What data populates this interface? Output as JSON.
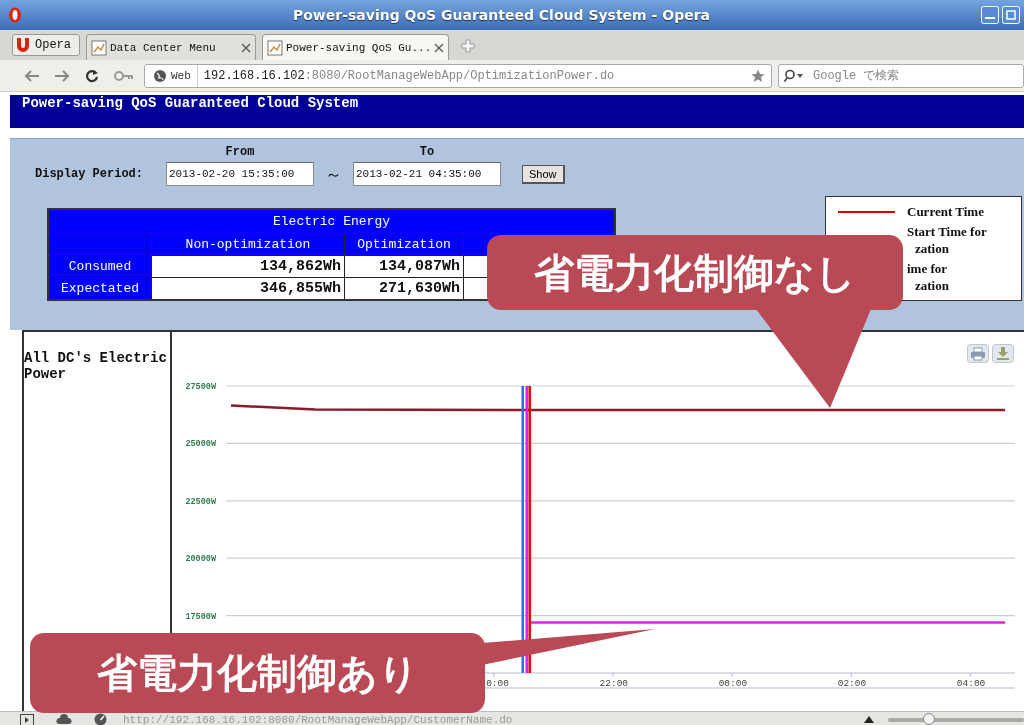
{
  "window": {
    "title": "Power-saving QoS Guaranteed Cloud System - Opera"
  },
  "browser": {
    "menu_label": "Opera",
    "tabs": [
      {
        "label": "Data Center Menu",
        "selected": false
      },
      {
        "label": "Power-saving QoS Gu...",
        "selected": true
      }
    ],
    "address": {
      "badge": "Web",
      "host": "192.168.16.102",
      "path": ":8080/RootManageWebApp/OptimizationPower.do"
    },
    "search": {
      "placeholder": "Google で検索"
    }
  },
  "page": {
    "header": "Power-saving QoS Guaranteed Cloud System",
    "period": {
      "label": "Display Period:",
      "from_label": "From",
      "to_label": "To",
      "from": "2013-02-20 15:35:00",
      "separator": "～",
      "to": "2013-02-21 04:35:00",
      "button": "Show"
    },
    "energy_table": {
      "title": "Electric Energy",
      "columns": [
        "Non-optimization",
        "Optimization"
      ],
      "rows": [
        {
          "label": "Consumed",
          "cells": [
            "134,862Wh",
            "134,087Wh"
          ]
        },
        {
          "label": "Expectated",
          "cells": [
            "346,855Wh",
            "271,630Wh"
          ]
        }
      ]
    },
    "legend": [
      {
        "lines": [
          "Current Time"
        ],
        "color": "#e00000"
      },
      {
        "lines": [
          "Start Time for",
          "zation"
        ]
      },
      {
        "lines": [
          "ime for",
          "zation"
        ]
      }
    ],
    "chart_panel": {
      "title": "All DC's Electric Power",
      "chart_data": {
        "type": "line",
        "grid": true,
        "x": [
          "2013-02-20T15:35",
          "2013-02-20T17:00",
          "2013-02-20T20:30",
          "2013-02-20T20:36",
          "2013-02-21T04:35"
        ],
        "series": [
          {
            "color": "#8b1a2b",
            "values": [
              26650,
              26480,
              26450,
              26450,
              26450
            ]
          },
          {
            "color": "#e020e0",
            "values": [
              null,
              null,
              null,
              17200,
              17200
            ]
          }
        ],
        "xlim": [
          "2013-02-20T15:30",
          "2013-02-21T04:45"
        ],
        "ylim": [
          15000,
          27500
        ],
        "xticks": [
          {
            "value": "2013-02-20T20:00",
            "label": "0:00"
          },
          {
            "value": "2013-02-20T22:00",
            "label": "22:00"
          },
          {
            "value": "2013-02-21T00:00",
            "label": "00:00"
          },
          {
            "value": "2013-02-21T02:00",
            "label": "02:00"
          },
          {
            "value": "2013-02-21T04:00",
            "label": "04:00"
          }
        ],
        "yticks": [
          {
            "value": 17500,
            "label": "17500W"
          },
          {
            "value": 20000,
            "label": "20000W"
          },
          {
            "value": 22500,
            "label": "22500W"
          },
          {
            "value": 25000,
            "label": "25000W"
          },
          {
            "value": 27500,
            "label": "27500W"
          }
        ],
        "ref_lines": [
          {
            "axis": "x",
            "value": "2013-02-20T20:29",
            "color": "#2f6fd6"
          },
          {
            "axis": "x",
            "value": "2013-02-20T20:33",
            "color": "#e020e0"
          },
          {
            "axis": "x",
            "value": "2013-02-20T20:36",
            "color": "#e00000"
          }
        ]
      }
    }
  },
  "callouts": [
    {
      "text": "省電力化制御なし"
    },
    {
      "text": "省電力化制御あり"
    }
  ],
  "status_bar": {
    "url": "http://192.168.16.102:8080/RootManageWebApp/CustomerName.do",
    "zoom": {
      "level": 0.3
    }
  }
}
